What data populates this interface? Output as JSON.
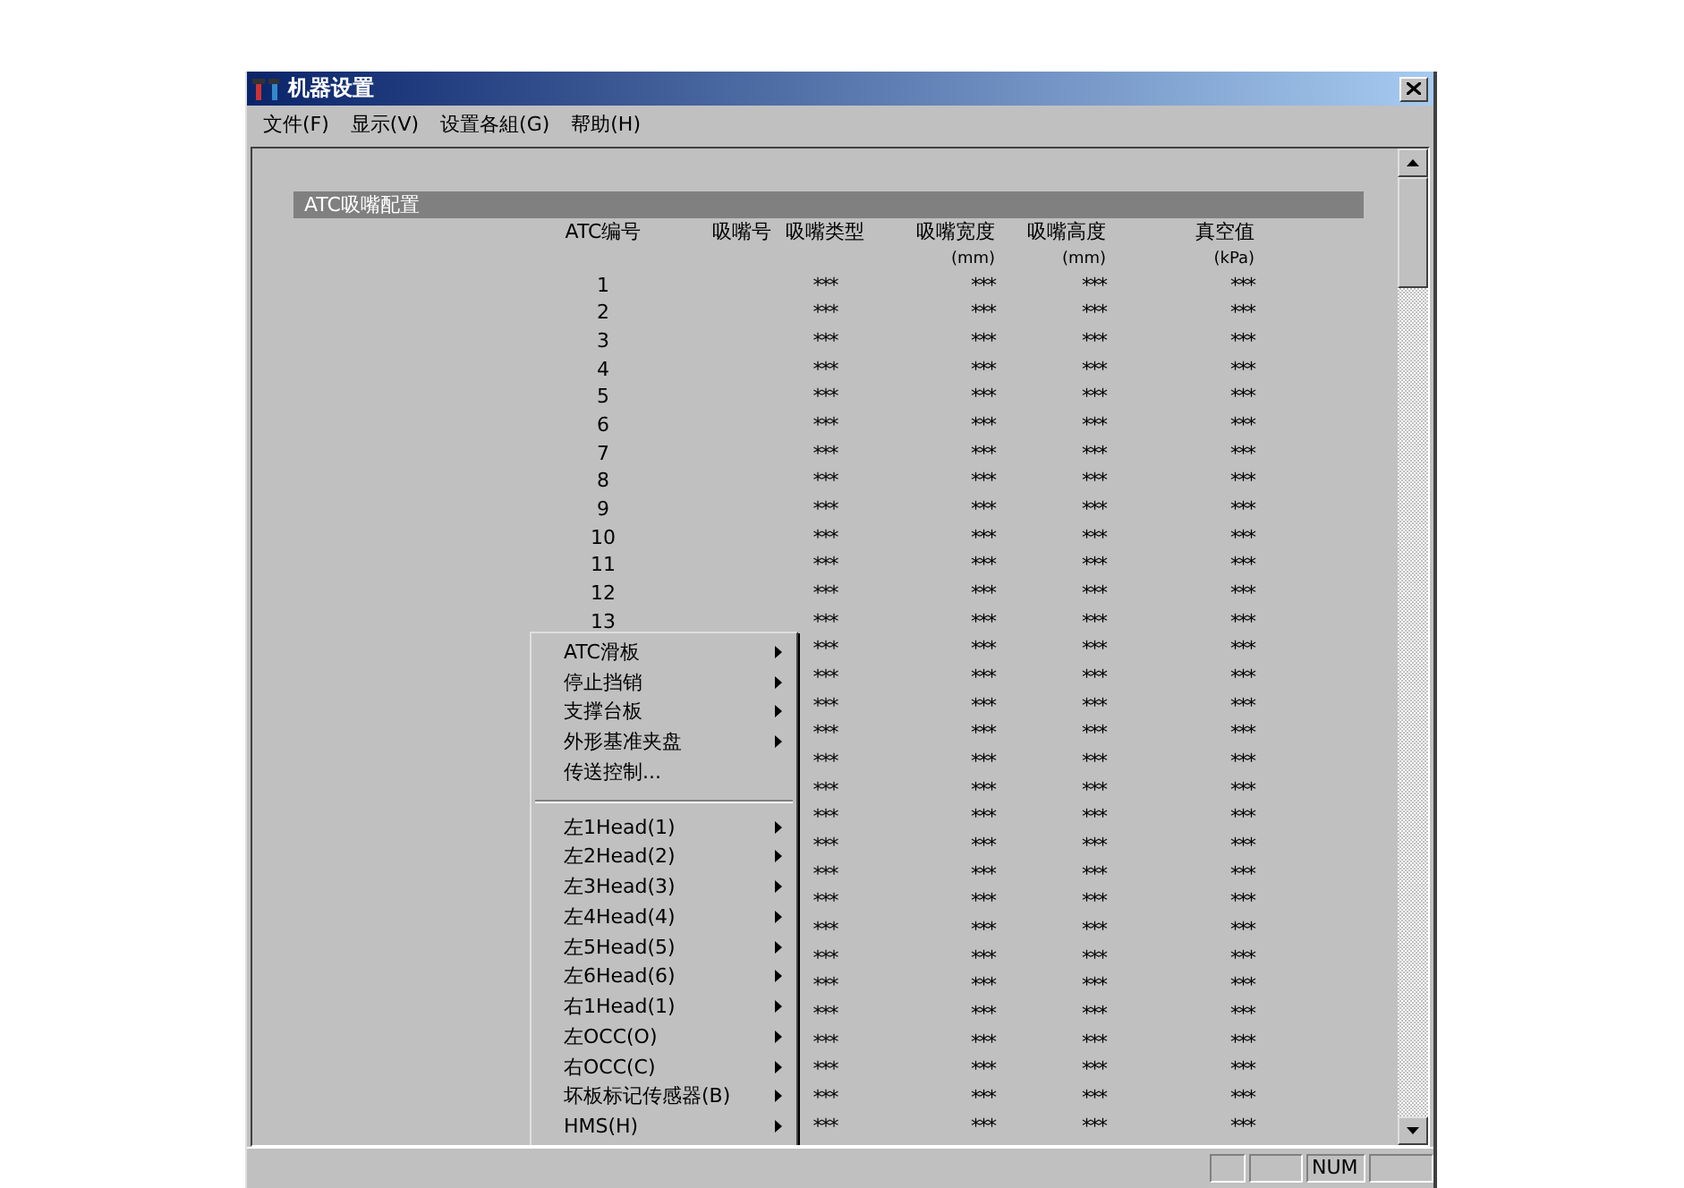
{
  "window": {
    "title": "机器设置"
  },
  "menu_bar": [
    "文件(F)",
    "显示(V)",
    "设置各組(G)",
    "帮助(H)"
  ],
  "section": {
    "title": "ATC吸嘴配置"
  },
  "table": {
    "columns": [
      {
        "label": "ATC编号"
      },
      {
        "label": "吸嘴号"
      },
      {
        "label": "吸嘴类型"
      },
      {
        "label": "吸嘴宽度",
        "unit": "(mm)"
      },
      {
        "label": "吸嘴高度",
        "unit": "(mm)"
      },
      {
        "label": "真空值",
        "unit": "(kPa)"
      }
    ],
    "rows": [
      {
        "cells": [
          "1",
          "",
          "***",
          "***",
          "***",
          "***"
        ]
      },
      {
        "cells": [
          "2",
          "",
          "***",
          "***",
          "***",
          "***"
        ]
      },
      {
        "cells": [
          "3",
          "",
          "***",
          "***",
          "***",
          "***"
        ]
      },
      {
        "cells": [
          "4",
          "",
          "***",
          "***",
          "***",
          "***"
        ]
      },
      {
        "cells": [
          "5",
          "",
          "***",
          "***",
          "***",
          "***"
        ]
      },
      {
        "cells": [
          "6",
          "",
          "***",
          "***",
          "***",
          "***"
        ]
      },
      {
        "cells": [
          "7",
          "",
          "***",
          "***",
          "***",
          "***"
        ]
      },
      {
        "cells": [
          "8",
          "",
          "***",
          "***",
          "***",
          "***"
        ]
      },
      {
        "cells": [
          "9",
          "",
          "***",
          "***",
          "***",
          "***"
        ]
      },
      {
        "cells": [
          "10",
          "",
          "***",
          "***",
          "***",
          "***"
        ]
      },
      {
        "cells": [
          "11",
          "",
          "***",
          "***",
          "***",
          "***"
        ]
      },
      {
        "cells": [
          "12",
          "",
          "***",
          "***",
          "***",
          "***"
        ]
      },
      {
        "cells": [
          "13",
          "",
          "***",
          "***",
          "***",
          "***"
        ]
      },
      {
        "cells": [
          "",
          "",
          "***",
          "***",
          "***",
          "***"
        ]
      },
      {
        "cells": [
          "",
          "",
          "***",
          "***",
          "***",
          "***"
        ]
      },
      {
        "cells": [
          "",
          "",
          "***",
          "***",
          "***",
          "***"
        ]
      },
      {
        "cells": [
          "",
          "",
          "***",
          "***",
          "***",
          "***"
        ]
      },
      {
        "cells": [
          "",
          "",
          "***",
          "***",
          "***",
          "***"
        ]
      },
      {
        "cells": [
          "",
          "",
          "***",
          "***",
          "***",
          "***"
        ]
      },
      {
        "cells": [
          "",
          "",
          "***",
          "***",
          "***",
          "***"
        ]
      },
      {
        "cells": [
          "",
          "",
          "***",
          "***",
          "***",
          "***"
        ]
      },
      {
        "cells": [
          "",
          "",
          "***",
          "***",
          "***",
          "***"
        ]
      },
      {
        "cells": [
          "",
          "",
          "***",
          "***",
          "***",
          "***"
        ]
      },
      {
        "cells": [
          "",
          "",
          "***",
          "***",
          "***",
          "***"
        ]
      },
      {
        "cells": [
          "",
          "",
          "***",
          "***",
          "***",
          "***"
        ]
      },
      {
        "cells": [
          "",
          "",
          "***",
          "***",
          "***",
          "***"
        ]
      },
      {
        "cells": [
          "",
          "",
          "***",
          "***",
          "***",
          "***"
        ]
      },
      {
        "cells": [
          "",
          "",
          "***",
          "***",
          "***",
          "***"
        ]
      },
      {
        "cells": [
          "",
          "",
          "***",
          "***",
          "***",
          "***"
        ]
      },
      {
        "cells": [
          "",
          "",
          "***",
          "***",
          "***",
          "***"
        ]
      },
      {
        "cells": [
          "",
          "",
          "***",
          "***",
          "***",
          "***"
        ]
      }
    ]
  },
  "context_menu": [
    {
      "kind": "submenu",
      "label": "ATC滑板"
    },
    {
      "kind": "submenu",
      "label": "停止挡销"
    },
    {
      "kind": "submenu",
      "label": "支撑台板"
    },
    {
      "kind": "submenu",
      "label": "外形基准夹盘"
    },
    {
      "kind": "command",
      "label": "传送控制..."
    },
    {
      "kind": "separator"
    },
    {
      "kind": "submenu",
      "label": "左1Head(1)"
    },
    {
      "kind": "submenu",
      "label": "左2Head(2)"
    },
    {
      "kind": "submenu",
      "label": "左3Head(3)"
    },
    {
      "kind": "submenu",
      "label": "左4Head(4)"
    },
    {
      "kind": "submenu",
      "label": "左5Head(5)"
    },
    {
      "kind": "submenu",
      "label": "左6Head(6)"
    },
    {
      "kind": "submenu",
      "label": "右1Head(1)"
    },
    {
      "kind": "submenu",
      "label": "左OCC(O)"
    },
    {
      "kind": "submenu",
      "label": "右OCC(C)"
    },
    {
      "kind": "submenu",
      "label": "坏板标记传感器(B)"
    },
    {
      "kind": "submenu",
      "label": "HMS(H)"
    }
  ],
  "status_bar": [
    {
      "kind": "blank"
    },
    {
      "kind": "blank"
    },
    {
      "kind": "text",
      "text": "NUM"
    },
    {
      "kind": "blank"
    }
  ]
}
